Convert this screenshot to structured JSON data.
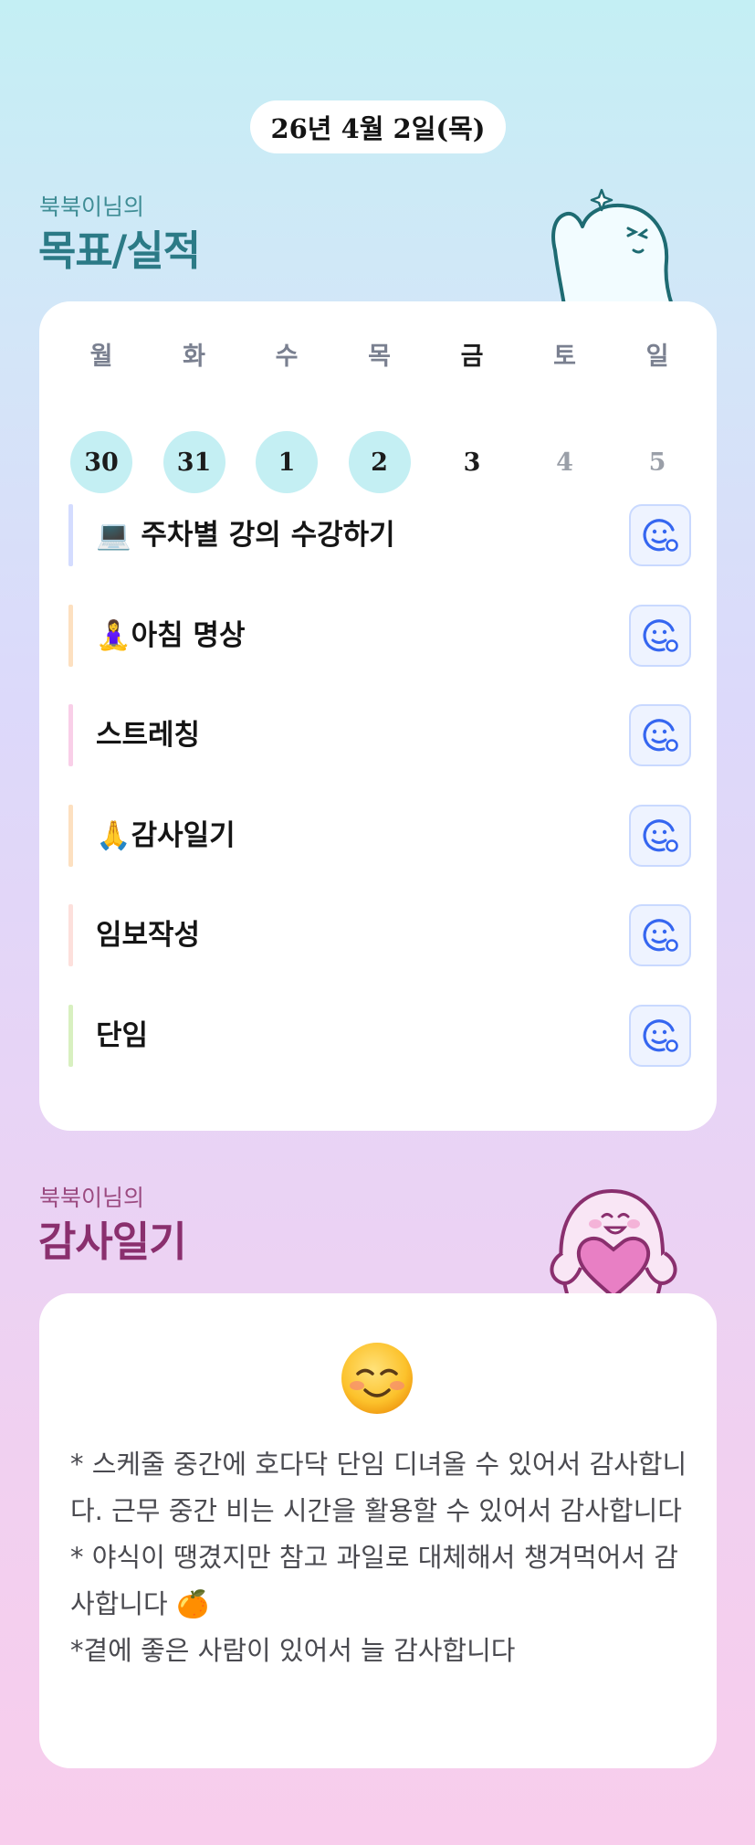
{
  "header": {
    "date": "26년 4월 2일(목)"
  },
  "goals_section": {
    "subtitle": "북북이님의",
    "title": "목표/실적"
  },
  "week": {
    "days": [
      {
        "name": "월",
        "num": "30",
        "state": "done"
      },
      {
        "name": "화",
        "num": "31",
        "state": "done"
      },
      {
        "name": "수",
        "num": "1",
        "state": "done"
      },
      {
        "name": "목",
        "num": "2",
        "state": "done"
      },
      {
        "name": "금",
        "num": "3",
        "state": "today"
      },
      {
        "name": "토",
        "num": "4",
        "state": "future"
      },
      {
        "name": "일",
        "num": "5",
        "state": "future"
      }
    ]
  },
  "habits": [
    {
      "label": "💻 주차별 강의 수강하기",
      "color": "#d4dcff"
    },
    {
      "label": "🧘‍♀️아침 명상",
      "color": "#fde0c0"
    },
    {
      "label": "스트레칭",
      "color": "#f9cfe8"
    },
    {
      "label": "🙏감사일기",
      "color": "#fde0c0"
    },
    {
      "label": "임보작성",
      "color": "#fde0dc"
    },
    {
      "label": "단임",
      "color": "#d8f0c0"
    }
  ],
  "gratitude_section": {
    "subtitle": "북북이님의",
    "title": "감사일기"
  },
  "gratitude": {
    "mood_emoji": "☺️",
    "lines": [
      "* 스케줄 중간에 호다닥 단임 디녀올 수 있어서 감사합니다. 근무 중간 비는 시간을 활용할 수 있어서 감사합니다",
      "* 야식이 땡겼지만 참고 과일로 대체해서 챙겨먹어서 감사합니다 🍊",
      "*곁에 좋은 사람이 있어서 늘 감사합니다"
    ]
  },
  "colors": {
    "goals_title": "#2b7a86",
    "gratitude_title": "#8a2f6e",
    "done_circle": "#c4eff3",
    "check_icon": "#3566f0"
  },
  "icons": {
    "check_button": "smiley-face-add-icon",
    "mascot_top": "waving-ghost-mascot",
    "mascot_bottom": "heart-holding-ghost-mascot"
  }
}
